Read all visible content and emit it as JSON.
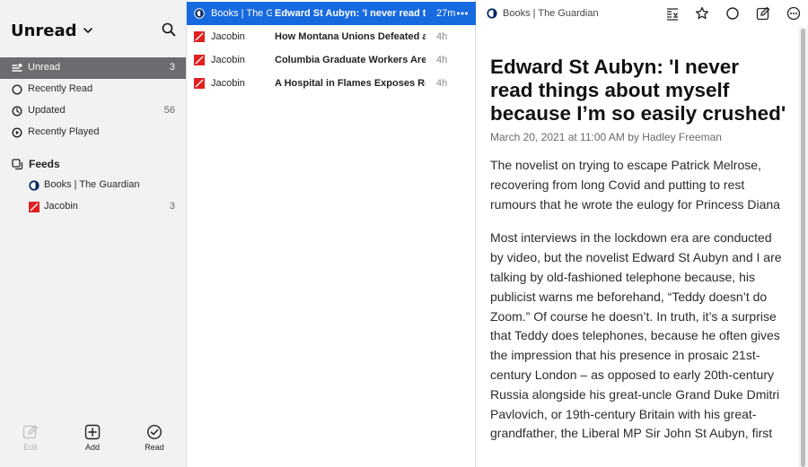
{
  "sidebar": {
    "title": "Unread",
    "smart_feeds": [
      {
        "label": "Unread",
        "count": "3",
        "icon": "unread-icon"
      },
      {
        "label": "Recently Read",
        "count": "",
        "icon": "circle-icon"
      },
      {
        "label": "Updated",
        "count": "56",
        "icon": "clock-icon"
      },
      {
        "label": "Recently Played",
        "count": "",
        "icon": "play-icon"
      }
    ],
    "feeds_label": "Feeds",
    "feeds": [
      {
        "label": "Books | The Guardian",
        "count": "",
        "icon": "guardian-icon"
      },
      {
        "label": "Jacobin",
        "count": "3",
        "icon": "jacobin-icon"
      }
    ],
    "footer": {
      "edit": "Edit",
      "add": "Add",
      "read": "Read"
    }
  },
  "list": {
    "items": [
      {
        "source": "Books | The Guardian",
        "title": "Edward St Aubyn: 'I never read things about myself because I'm so easily crushed'",
        "time": "27m"
      },
      {
        "source": "Jacobin",
        "title": "How Montana Unions Defeated a",
        "time": "4h"
      },
      {
        "source": "Jacobin",
        "title": "Columbia Graduate Workers Are",
        "time": "4h"
      },
      {
        "source": "Jacobin",
        "title": "A Hospital in Flames Exposes Ror",
        "time": "4h"
      }
    ]
  },
  "reader": {
    "source": "Books | The Guardian",
    "title": "Edward St Aubyn: 'I never read things about myself because I’m so easily crushed'",
    "meta": "March 20, 2021 at 11:00 AM by Hadley Freeman",
    "standfirst": "The novelist on trying to escape Patrick Melrose, recovering from long Covid and putting to rest rumours that he wrote the eulogy for Princess Diana",
    "paragraph": "Most interviews in the lockdown era are conducted by video, but the novelist Edward St Aubyn and I are talking by old-fashioned telephone because, his publicist warns me beforehand, “Teddy doesn’t do Zoom.” Of course he doesn’t. In truth, it’s a surprise that Teddy does telephones, because he often gives the impression that his presence in prosaic 21st-century London – as opposed to early 20th-century Russia alongside his great-uncle Grand Duke Dmitri Pavlovich, or 19th-century Britain with his great-grandfather, the Liberal MP Sir John St Aubyn, first"
  },
  "colors": {
    "selection_blue": "#1769e0",
    "sidebar_selected": "#6c6c70",
    "jacobin_red": "#e02020",
    "guardian_navy": "#052962"
  }
}
